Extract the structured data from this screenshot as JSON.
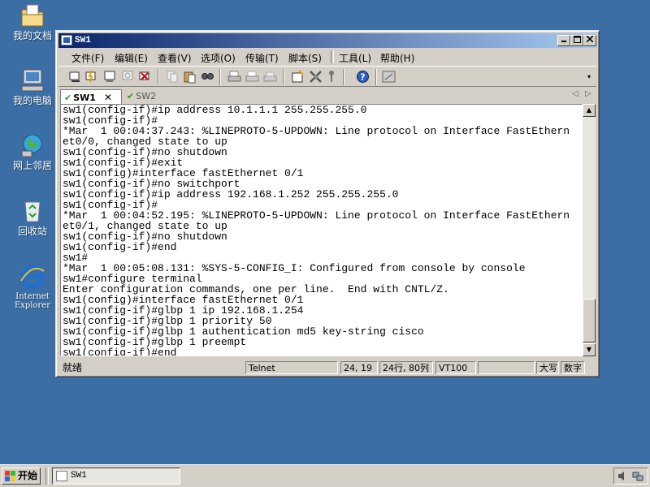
{
  "desktop": {
    "icons": [
      {
        "label": "我的文档",
        "icon": "my-documents-icon"
      },
      {
        "label": "我的电脑",
        "icon": "my-computer-icon"
      },
      {
        "label": "网上邻居",
        "icon": "network-places-icon"
      },
      {
        "label": "回收站",
        "icon": "recycle-bin-icon"
      },
      {
        "label_line1": "Internet",
        "label_line2": "Explorer",
        "icon": "internet-explorer-icon"
      }
    ]
  },
  "window": {
    "title": "SW1",
    "menu": [
      "文件(F)",
      "编辑(E)",
      "查看(V)",
      "选项(O)",
      "传输(T)",
      "脚本(S)",
      "工具(L)",
      "帮助(H)"
    ],
    "tabs": [
      {
        "label": "SW1",
        "active": true
      },
      {
        "label": "SW2",
        "active": false
      }
    ],
    "terminal_lines": [
      "sw1(config-if)#ip address 10.1.1.1 255.255.255.0",
      "sw1(config-if)#",
      "*Mar  1 00:04:37.243: %LINEPROTO-5-UPDOWN: Line protocol on Interface FastEthern",
      "et0/0, changed state to up",
      "sw1(config-if)#no shutdown",
      "sw1(config-if)#exit",
      "sw1(config)#interface fastEthernet 0/1",
      "sw1(config-if)#no switchport",
      "sw1(config-if)#ip address 192.168.1.252 255.255.255.0",
      "sw1(config-if)#",
      "*Mar  1 00:04:52.195: %LINEPROTO-5-UPDOWN: Line protocol on Interface FastEthern",
      "et0/1, changed state to up",
      "sw1(config-if)#no shutdown",
      "sw1(config-if)#end",
      "sw1#",
      "*Mar  1 00:05:08.131: %SYS-5-CONFIG_I: Configured from console by console",
      "sw1#configure terminal",
      "Enter configuration commands, one per line.  End with CNTL/Z.",
      "sw1(config)#interface fastEthernet 0/1",
      "sw1(config-if)#glbp 1 ip 192.168.1.254",
      "sw1(config-if)#glbp 1 priority 50",
      "sw1(config-if)#glbp 1 authentication md5 key-string cisco",
      "sw1(config-if)#glbp 1 preempt",
      "sw1(config-if)#end"
    ],
    "status": {
      "ready": "就绪",
      "protocol": "Telnet",
      "cursor": "24, 19",
      "size": "24行, 80列",
      "emulation": "VT100",
      "extra": "",
      "caps": "大写",
      "num": "数字"
    }
  },
  "taskbar": {
    "start_label": "开始",
    "task_label": "SW1"
  },
  "colors": {
    "desktop": "#3a6ea5",
    "title_start": "#0a246a",
    "title_end": "#a6caf0",
    "chrome": "#d4d0c8"
  }
}
